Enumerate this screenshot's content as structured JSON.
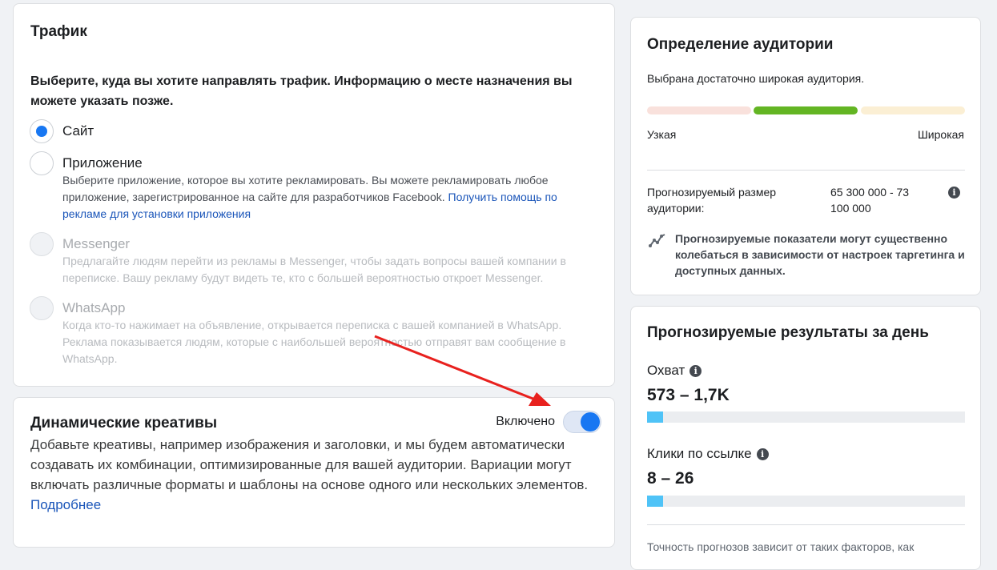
{
  "traffic": {
    "title": "Трафик",
    "description": "Выберите, куда вы хотите направлять трафик. Информацию о месте назначения вы можете указать позже.",
    "options": [
      {
        "label": "Сайт",
        "checked": true,
        "disabled": false,
        "description": ""
      },
      {
        "label": "Приложение",
        "checked": false,
        "disabled": false,
        "description": "Выберите приложение, которое вы хотите рекламировать. Вы можете рекламировать любое приложение, зарегистрированное на сайте для разработчиков Facebook.",
        "link": "Получить помощь по рекламе для установки приложения"
      },
      {
        "label": "Messenger",
        "checked": false,
        "disabled": true,
        "description": "Предлагайте людям перейти из рекламы в Messenger, чтобы задать вопросы вашей компании в переписке. Вашу рекламу будут видеть те, кто с большей вероятностью откроет Messenger."
      },
      {
        "label": "WhatsApp",
        "checked": false,
        "disabled": true,
        "description": "Когда кто-то нажимает на объявление, открывается переписка с вашей компанией в WhatsApp. Реклама показывается людям, которые с наибольшей вероятностью отправят вам сообщение в WhatsApp."
      }
    ]
  },
  "dynamic": {
    "title": "Динамические креативы",
    "toggle_label": "Включено",
    "toggle_on": true,
    "description": "Добавьте креативы, например изображения и заголовки, и мы будем автоматически создавать их комбинации, оптимизированные для вашей аудитории. Вариации могут включать различные форматы и шаблоны на основе одного или нескольких элементов.",
    "link": "Подробнее"
  },
  "audience": {
    "title": "Определение аудитории",
    "status": "Выбрана достаточно широкая аудитория.",
    "narrow_label": "Узкая",
    "wide_label": "Широкая",
    "size_label": "Прогнозируемый размер аудитории:",
    "size_value": "65 300 000 - 73 100 000",
    "note": "Прогнозируемые показатели могут существенно колебаться в зависимости от настроек таргетинга и доступных данных."
  },
  "results": {
    "title": "Прогнозируемые результаты за день",
    "reach_label": "Охват",
    "reach_value": "573 – 1,7K",
    "reach_fill": 0.05,
    "clicks_label": "Клики по ссылке",
    "clicks_value": "8 – 26",
    "clicks_fill": 0.05,
    "footer": "Точность прогнозов зависит от таких факторов, как"
  },
  "colors": {
    "accent": "#1877f2",
    "meter_selected": "#63b523",
    "bar_fill": "#4fc3f7",
    "arrow": "#e8211e"
  },
  "icons": {
    "info": "info-icon",
    "trend": "trend-icon",
    "arrow": "red-arrow-annotation"
  }
}
